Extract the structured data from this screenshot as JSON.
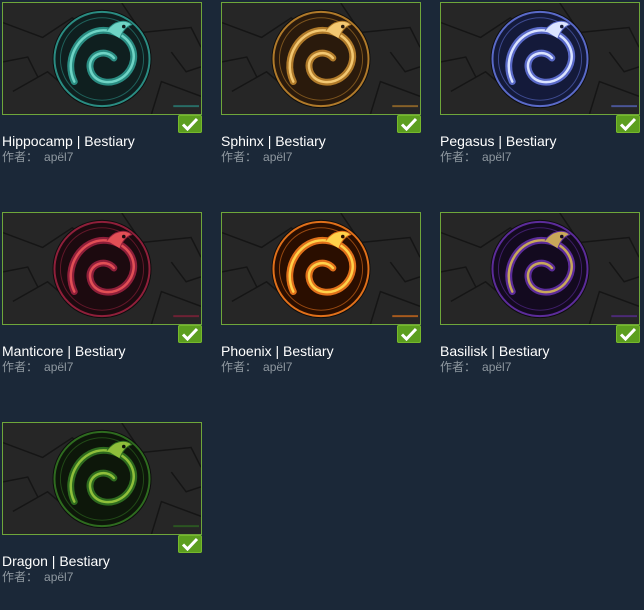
{
  "author_prefix": "作者：",
  "accent": "#6ea63a",
  "items": [
    {
      "title": "Hippocamp | Bestiary",
      "author": "apël7",
      "art": "hippocamp-emblem",
      "palette": [
        "#0f1f1f",
        "#2a8c82",
        "#6fd4c5"
      ]
    },
    {
      "title": "Sphinx | Bestiary",
      "author": "apël7",
      "art": "sphinx-emblem",
      "palette": [
        "#2a1a0c",
        "#b07a2a",
        "#f3c872"
      ]
    },
    {
      "title": "Pegasus | Bestiary",
      "author": "apël7",
      "art": "pegasus-emblem",
      "palette": [
        "#141a3a",
        "#5a6ac8",
        "#dbe4ff"
      ]
    },
    {
      "title": "Manticore | Bestiary",
      "author": "apël7",
      "art": "manticore-emblem",
      "palette": [
        "#1c0a0f",
        "#8f1f3a",
        "#e24f55"
      ]
    },
    {
      "title": "Phoenix | Bestiary",
      "author": "apël7",
      "art": "phoenix-emblem",
      "palette": [
        "#2a0e00",
        "#e0701a",
        "#ffd24a"
      ]
    },
    {
      "title": "Basilisk | Bestiary",
      "author": "apël7",
      "art": "basilisk-emblem",
      "palette": [
        "#130a1f",
        "#5c2c9a",
        "#c8a85a"
      ]
    },
    {
      "title": "Dragon | Bestiary",
      "author": "apël7",
      "art": "dragon-emblem",
      "palette": [
        "#0d170a",
        "#2e6b1f",
        "#8fbf3a"
      ]
    }
  ]
}
